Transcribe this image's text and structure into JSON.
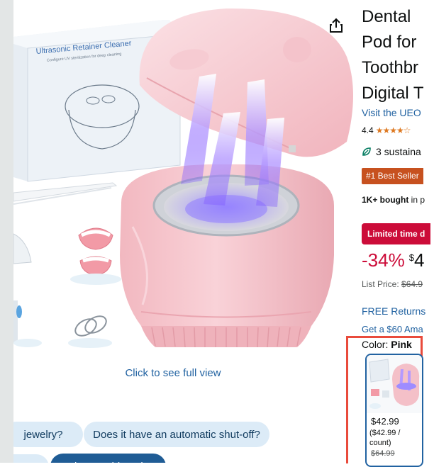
{
  "gallery": {
    "box_title": "Ultrasonic Retainer Cleaner",
    "box_subtitle": "Configure UV sterilization for deep cleaning",
    "view_caption": "Click to see full view",
    "share_icon": "share-icon"
  },
  "questions": {
    "chip1": "jewelry?",
    "chip2": "Does it have an automatic shut-off?",
    "chip3": "Ask something else"
  },
  "product": {
    "title_lines": [
      "Dental",
      "Pod for",
      "Toothbr",
      "Digital T"
    ],
    "store_link": "Visit the UEO",
    "rating_value": "4.4",
    "rating_stars": "★★★★☆",
    "sustainability": "3 sustaina",
    "best_seller": "#1 Best Seller",
    "bought_bold": "1K+ bought",
    "bought_rest": " in p",
    "limited_deal": "Limited time d",
    "discount": "-34%",
    "currency": "$",
    "price_whole": "4",
    "list_price_label": "List Price: ",
    "list_price_value": "$64.9",
    "free_returns": "FREE Returns",
    "gift_offer": "Get a $60 Ama",
    "color_label": "Color: ",
    "color_value": "Pink"
  },
  "swatch": {
    "price": "$42.99",
    "unit_price": "($42.99 / count)",
    "list_price": "$64.99"
  },
  "colors": {
    "link": "#2162a1",
    "deal_red": "#cc0c39",
    "best_seller": "#c7511f",
    "selection_box": "#e94b3c",
    "chip_bg": "#dcebf7"
  }
}
